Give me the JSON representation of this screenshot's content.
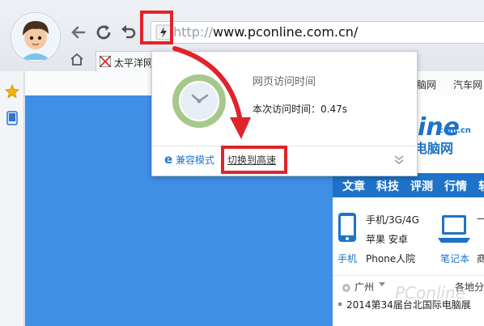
{
  "toolbar": {
    "url_prefix": "http://",
    "url_host": "www.pconline.com.cn/",
    "site_icon": "lightning-icon"
  },
  "bookmarks": {
    "first_tab_label": "太平洋网"
  },
  "site": {
    "nav_top_items": [
      "脑网",
      "汽车网"
    ],
    "logo_fragment": "ine",
    "logo_domain": ".com.cn",
    "logo_cn": "电脑网",
    "nav_items": [
      "文章",
      "科技",
      "评测",
      "行情",
      "软"
    ],
    "phone_category": "手机/3G/4G",
    "phone_brands": "苹果 安卓",
    "phone_label": "手机",
    "iphone_label": "Phone人院",
    "laptop_label": "笔记本",
    "laptop_extra": "商",
    "location_label": "广州",
    "location_right": "各地分",
    "headline": "2014第34届台北国际电脑展",
    "watermark": "PConline"
  },
  "popup": {
    "title": "网页访问时间",
    "visit_label": "本次访问时间：",
    "visit_value": "0.47s",
    "compat_mode": "兼容模式",
    "switch_fast": "切换到高速"
  },
  "colors": {
    "accent_red": "#e0242a",
    "site_blue": "#1e73c8",
    "content_blue": "#3f8fe6",
    "clock_green": "#a6c98b"
  }
}
